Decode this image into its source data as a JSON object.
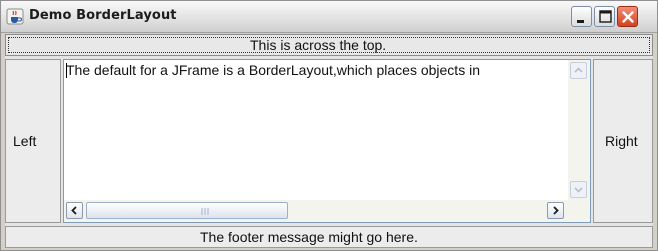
{
  "window": {
    "title": "Demo BorderLayout",
    "controls": {
      "minimize": "minimize",
      "maximize": "maximize",
      "close": "close"
    }
  },
  "layout": {
    "north": "This is across the top.",
    "west": "Left",
    "east": "Right",
    "south": "The footer message might go here.",
    "center": {
      "text": "The default for a JFrame is a BorderLayout,which places objects in"
    }
  },
  "icons": {
    "app": "java-coffee-cup-icon",
    "minimize": "minimize-icon",
    "maximize": "maximize-icon",
    "close": "close-icon",
    "scroll_up": "scroll-up-arrow-icon",
    "scroll_down": "scroll-down-arrow-icon",
    "scroll_left": "scroll-left-arrow-icon",
    "scroll_right": "scroll-right-arrow-icon"
  },
  "colors": {
    "close_button": "#d4421f",
    "textarea_border": "#7f9db9",
    "panel_background": "#e4e4e4"
  }
}
